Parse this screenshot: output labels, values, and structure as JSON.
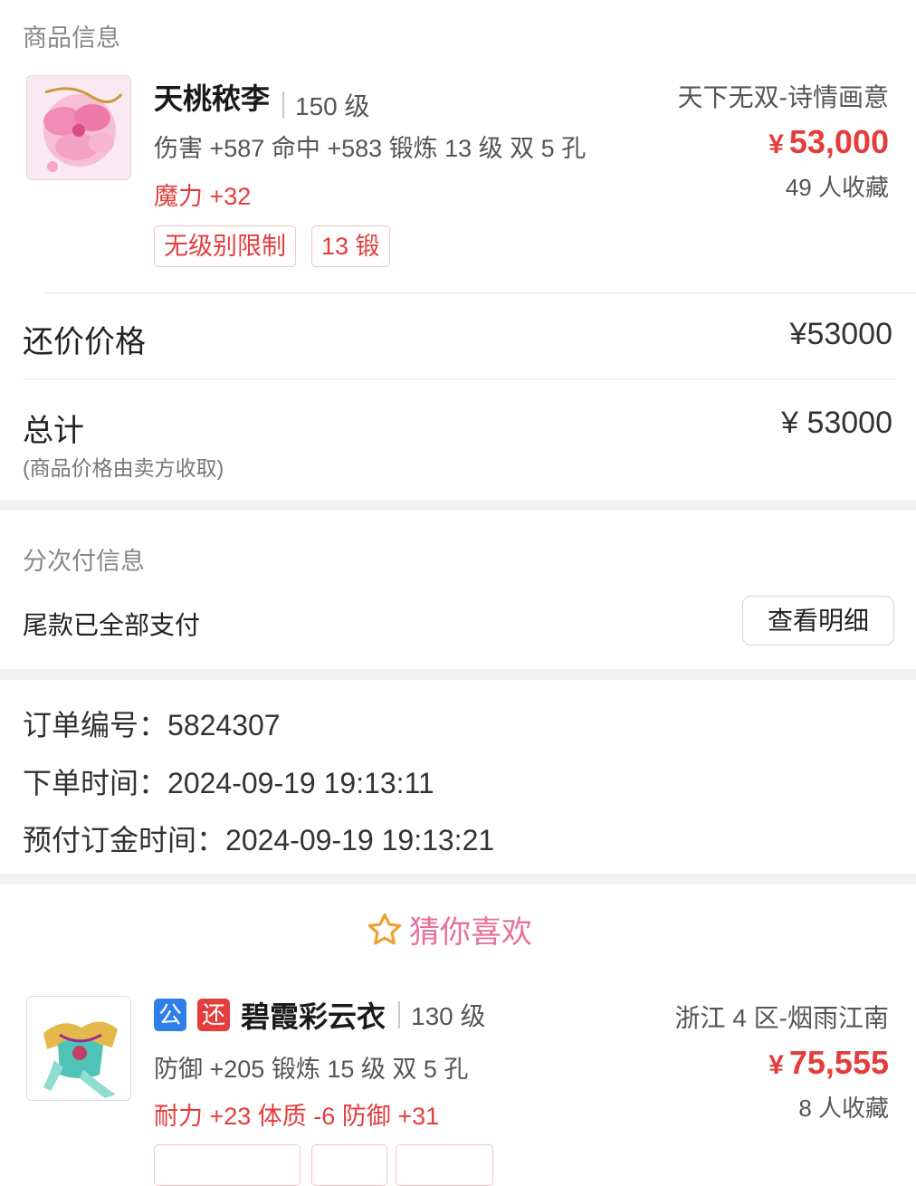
{
  "product": {
    "section_title": "商品信息",
    "name": "天桃秾李",
    "level": "150 级",
    "attrs": "伤害 +587 命中 +583 锻炼 13 级 双 5 孔",
    "bonus": "魔力 +32",
    "tags": [
      "无级别限制",
      "13 锻"
    ],
    "server": "天下无双-诗情画意",
    "currency": "¥",
    "price": "53,000",
    "favorites": "49 人收藏"
  },
  "counter_price": {
    "label": "还价价格",
    "value": "¥53000"
  },
  "total": {
    "label": "总计",
    "note": "(商品价格由卖方收取)",
    "value": "¥ 53000"
  },
  "installment": {
    "title": "分次付信息",
    "status": "尾款已全部支付",
    "detail_button": "查看明细"
  },
  "order": {
    "number_label": "订单编号：",
    "number": "5824307",
    "time_label": "下单时间：",
    "time": "2024-09-19 19:13:11",
    "deposit_label": "预付订金时间：",
    "deposit_time": "2024-09-19 19:13:21"
  },
  "recommend": {
    "title": "猜你喜欢",
    "item": {
      "badge_public": "公",
      "badge_bargain": "还",
      "name": "碧霞彩云衣",
      "level": "130 级",
      "attrs": "防御 +205 锻炼 15 级 双 5 孔",
      "bonus": "耐力 +23 体质 -6 防御 +31",
      "server": "浙江 4 区-烟雨江南",
      "currency": "¥",
      "price": "75,555",
      "favorites": "8 人收藏"
    }
  },
  "colors": {
    "accent_red": "#e43d3d",
    "badge_blue": "#2f7fe8",
    "star_orange": "#f0a030"
  }
}
